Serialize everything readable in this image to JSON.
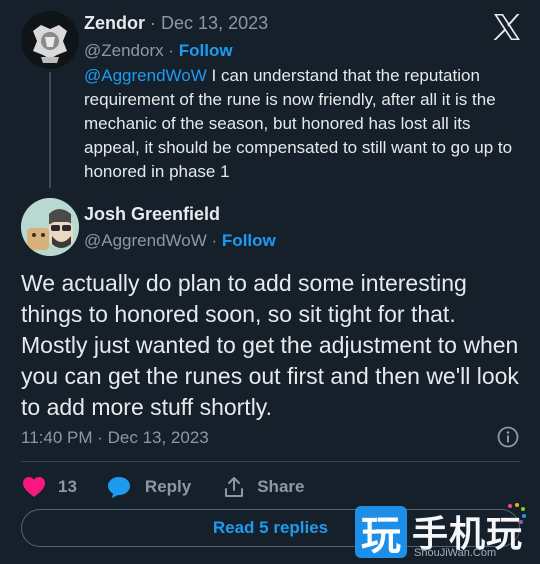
{
  "parent_tweet": {
    "author_name": "Zendor",
    "separator": "·",
    "date": "Dec 13, 2023",
    "handle": "@Zendorx",
    "follow_label": "Follow",
    "mention": "@AggrendWoW",
    "text": " I can understand that the reputation requirement of the rune is now friendly, after all it is the mechanic of the season, but honored has lost all its appeal, it should be compensated to still want to go up to honored in phase 1"
  },
  "reply_tweet": {
    "author_name": "Josh Greenfield",
    "handle": "@AggrendWoW",
    "separator": "·",
    "follow_label": "Follow",
    "text": "We actually do plan to add some interesting things to honored soon, so sit tight for that. Mostly just wanted to get the adjustment to when you can get the runes out first and then we'll look to add more stuff shortly.",
    "timestamp": "11:40 PM · Dec 13, 2023"
  },
  "actions": {
    "like_count": "13",
    "reply_label": "Reply",
    "share_label": "Share"
  },
  "read_replies_label": "Read 5 replies",
  "watermark": {
    "icon_char": "玩",
    "text": "手机玩",
    "url": "ShouJiWan.Com"
  },
  "colors": {
    "background": "#15202b",
    "accent": "#1d9bf0",
    "like": "#f91880",
    "muted": "#8b98a5"
  }
}
